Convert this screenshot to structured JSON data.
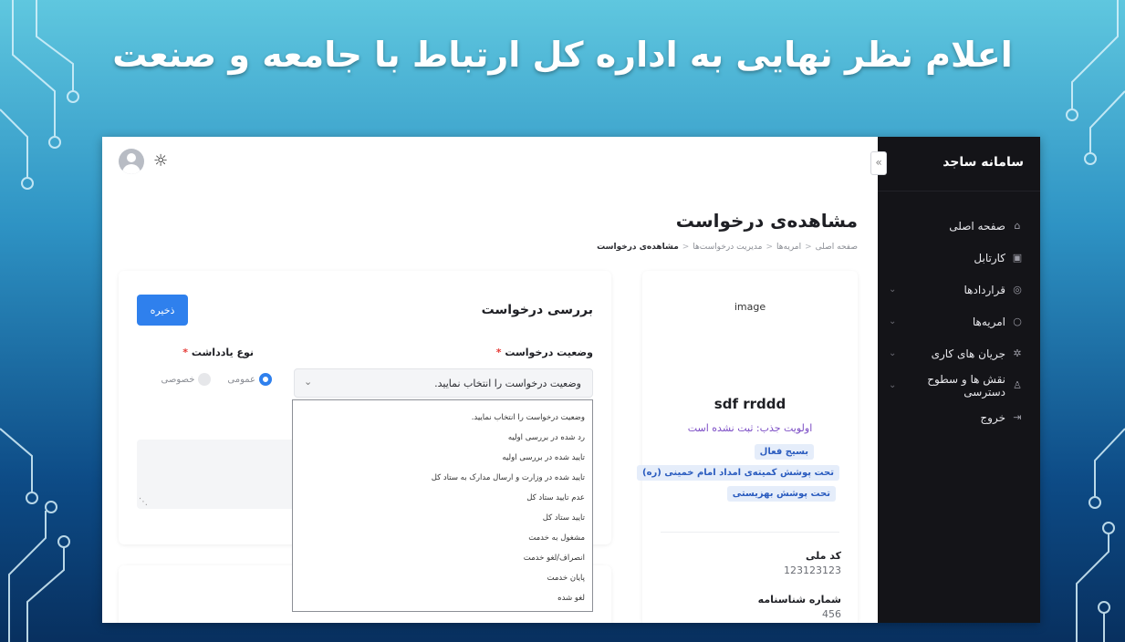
{
  "slide": {
    "title": "اعلام نظر نهایی به اداره کل ارتباط با جامعه و صنعت"
  },
  "sidebar": {
    "brand": "سامانه ساجد",
    "items": [
      {
        "label": "صفحه اصلی",
        "icon": "home-icon",
        "has_submenu": false
      },
      {
        "label": "کارتابل",
        "icon": "inbox-icon",
        "has_submenu": false
      },
      {
        "label": "قراردادها",
        "icon": "contract-icon",
        "has_submenu": true
      },
      {
        "label": "امریه‌ها",
        "icon": "circle-icon",
        "has_submenu": true
      },
      {
        "label": "جریان های کاری",
        "icon": "workflow-icon",
        "has_submenu": true
      },
      {
        "label": "نقش ها و سطوح دسترسی",
        "icon": "user-icon",
        "has_submenu": true
      },
      {
        "label": "خروج",
        "icon": "logout-icon",
        "has_submenu": false
      }
    ],
    "collapse_glyph": "«"
  },
  "header": {
    "avatar": "user-avatar",
    "theme_icon": "sun-icon"
  },
  "page": {
    "title": "مشاهده‌ی درخواست",
    "breadcrumb": [
      "صفحه اصلی",
      "امریه‌ها",
      "مدیریت درخواست‌ها",
      "مشاهده‌ی درخواست"
    ],
    "breadcrumb_sep": "<"
  },
  "profile": {
    "image_placeholder": "image",
    "name": "sdf rrddd",
    "priority": "اولویت جذب: ثبت نشده است",
    "tags": [
      "بسیج فعال",
      "تحت پوشش کمیته‌ی امداد امام خمینی (ره)",
      "تحت پوشش بهزیستی"
    ],
    "fields": [
      {
        "label": "کد ملی",
        "value": "123123123"
      },
      {
        "label": "شماره شناسنامه",
        "value": "456"
      }
    ]
  },
  "review": {
    "title": "بررسی درخواست",
    "save_label": "ذخیره",
    "status_label": "وضعیت درخواست",
    "status_placeholder": "وضعیت درخواست را انتخاب نمایید.",
    "select_arrow": "⌄",
    "note_type_label": "نوع یادداشت",
    "required_mark": "*",
    "note_types": [
      {
        "label": "عمومی",
        "selected": true
      },
      {
        "label": "خصوصی",
        "selected": false
      }
    ],
    "status_options": [
      "وضعیت درخواست را انتخاب نمایید.",
      "رد شده در بررسی اولیه",
      "تایید شده در بررسی اولیه",
      "تایید شده در وزارت و ارسال مدارک به ستاد کل",
      "عدم تایید ستاد کل",
      "تایید ستاد کل",
      "مشغول به خدمت",
      "انصراف/لغو خدمت",
      "پایان خدمت",
      "لغو شده"
    ]
  }
}
